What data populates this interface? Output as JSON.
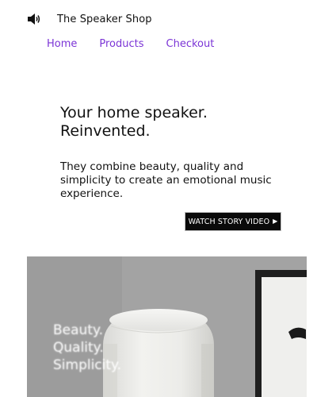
{
  "header": {
    "logo_icon": "speaker-volume-icon",
    "shop_name": "The Speaker Shop"
  },
  "nav": {
    "items": [
      {
        "label": "Home"
      },
      {
        "label": "Products"
      },
      {
        "label": "Checkout"
      }
    ],
    "link_color": "#7b34d6"
  },
  "hero": {
    "headline_line1": "Your home speaker.",
    "headline_line2": "Reinvented.",
    "subtext": "They combine beauty, quality and simplicity to create an emotional music experience.",
    "cta_label": "WATCH STORY VIDEO",
    "cta_icon": "play-triangle-icon",
    "image": {
      "tagline_lines": [
        "Beauty.",
        "Quality.",
        "Simplicity."
      ]
    }
  }
}
